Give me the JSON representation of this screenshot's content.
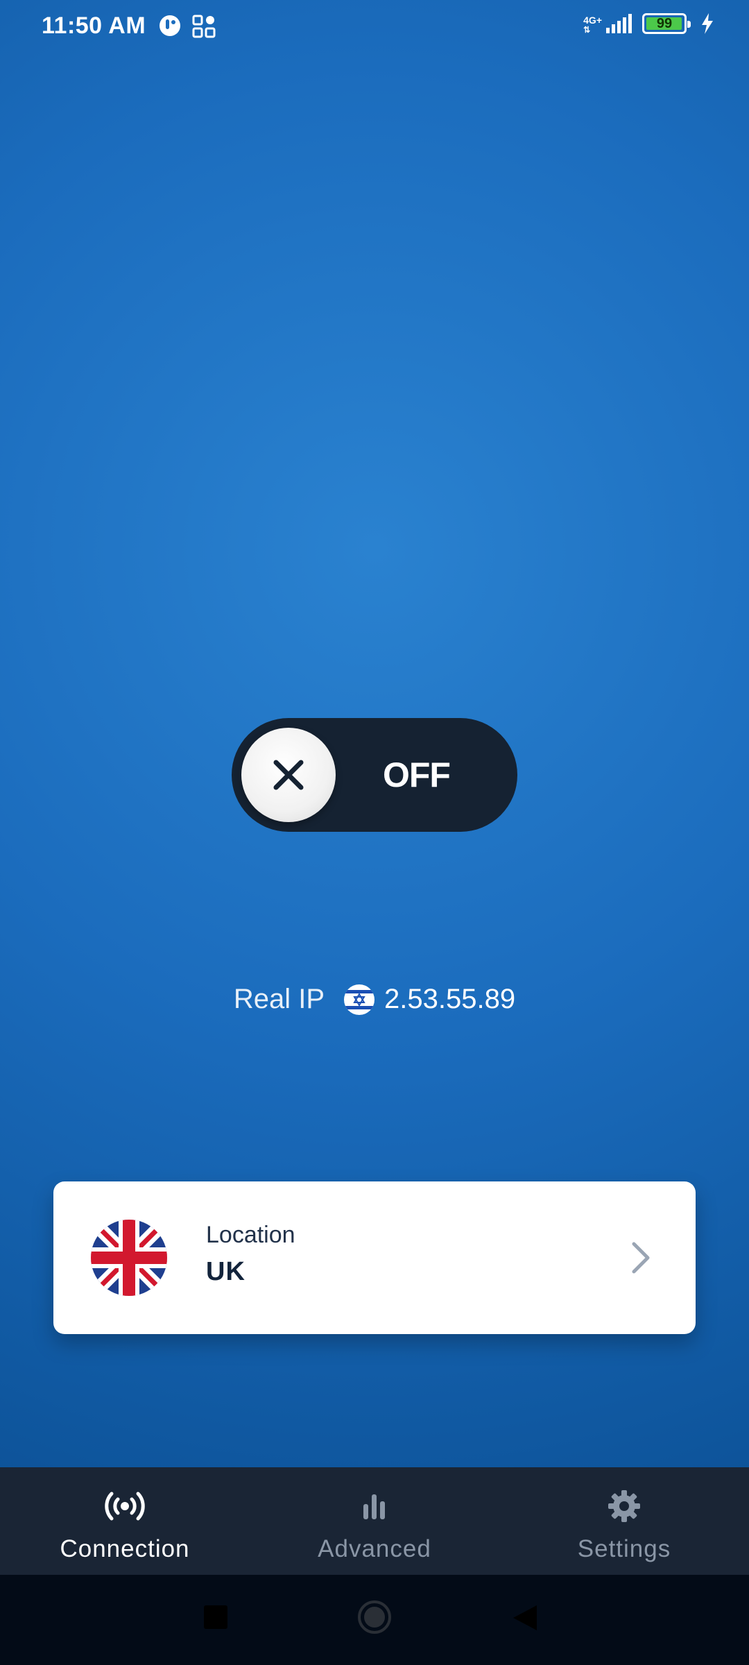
{
  "status_bar": {
    "time": "11:50 AM",
    "network": "4G+",
    "battery": "99",
    "battery_level": 0.99
  },
  "toggle": {
    "state_label": "OFF",
    "icon": "close-icon"
  },
  "ip_info": {
    "label": "Real IP",
    "flag": "israel-flag-icon",
    "address": "2.53.55.89"
  },
  "location_card": {
    "label": "Location",
    "value": "UK",
    "flag": "uk-flag-icon",
    "chevron": "chevron-right-icon"
  },
  "bottom_nav": {
    "items": [
      {
        "label": "Connection",
        "icon": "broadcast-icon",
        "active": true
      },
      {
        "label": "Advanced",
        "icon": "bar-chart-icon",
        "active": false
      },
      {
        "label": "Settings",
        "icon": "gear-icon",
        "active": false
      }
    ]
  },
  "colors": {
    "background": "#1b6cbd",
    "toggle_bg": "#152232",
    "nav_bg": "#1a2535",
    "nav_inactive": "#8a96a6",
    "text_dark": "#12233b"
  }
}
